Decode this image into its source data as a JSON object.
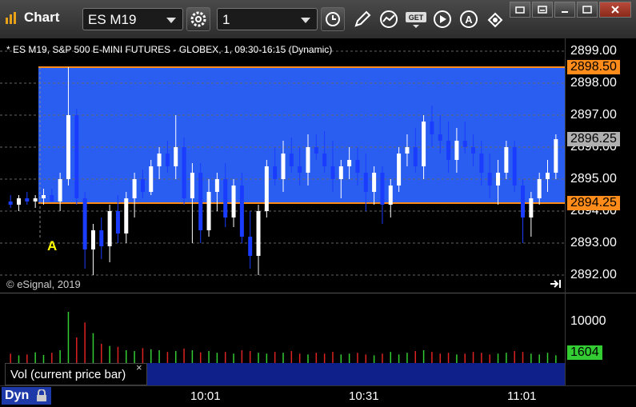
{
  "app": {
    "title": "Chart"
  },
  "toolbar": {
    "symbol": "ES M19",
    "interval": "1",
    "buttons": [
      "settings-icon",
      "clock-icon",
      "pencil-icon",
      "study-icon",
      "get-icon",
      "play-icon",
      "alert-icon",
      "link-icon"
    ]
  },
  "window": {
    "controls": [
      "restore",
      "minimize",
      "maximize",
      "close"
    ]
  },
  "chart": {
    "subtitle": "* ES M19, S&P 500 E-MINI FUTURES - GLOBEX, 1, 09:30-16:15 (Dynamic)",
    "copyright": "© eSignal, 2019",
    "marker": "A",
    "price_axis": [
      "2899.00",
      "2898.00",
      "2897.00",
      "2896.00",
      "2895.00",
      "2894.00",
      "2893.00",
      "2892.00"
    ],
    "price_tags": [
      {
        "label": "2898.50",
        "color": "#ff8c1a"
      },
      {
        "label": "2896.25",
        "color": "#b0b0b0"
      },
      {
        "label": "2894.25",
        "color": "#ff8c1a"
      }
    ],
    "range_box": {
      "high": 2898.5,
      "low": 2894.25,
      "color": "#2a5ef0"
    }
  },
  "volume": {
    "legend": "Vol (current price bar)",
    "close": "×",
    "axis_label": "10000",
    "current_tag": "1604",
    "current_color": "#33cc33"
  },
  "time_axis": [
    "10:01",
    "10:31",
    "11:01"
  ],
  "bottom": {
    "mode": "Dyn"
  },
  "chart_data": {
    "type": "candlestick",
    "title": "* ES M19, S&P 500 E-MINI FUTURES - GLOBEX, 1, 09:30-16:15 (Dynamic)",
    "ylim": [
      2891.5,
      2899.4
    ],
    "x_ticks": [
      "10:01",
      "10:31",
      "11:01"
    ],
    "candles": [
      [
        2894.3,
        2894.5,
        2894.1,
        2894.2
      ],
      [
        2894.2,
        2894.5,
        2894.0,
        2894.4
      ],
      [
        2894.4,
        2894.6,
        2894.2,
        2894.3
      ],
      [
        2894.3,
        2894.5,
        2894.1,
        2894.4
      ],
      [
        2894.4,
        2894.7,
        2894.2,
        2894.5
      ],
      [
        2894.5,
        2894.7,
        2894.3,
        2894.3
      ],
      [
        2894.3,
        2895.2,
        2894.0,
        2895.0
      ],
      [
        2895.0,
        2898.5,
        2894.8,
        2897.0
      ],
      [
        2897.0,
        2897.2,
        2894.2,
        2894.4
      ],
      [
        2894.4,
        2894.6,
        2892.2,
        2892.8
      ],
      [
        2892.8,
        2893.6,
        2892.0,
        2893.4
      ],
      [
        2893.4,
        2893.8,
        2892.5,
        2892.9
      ],
      [
        2892.9,
        2894.2,
        2892.4,
        2894.0
      ],
      [
        2894.0,
        2894.5,
        2893.0,
        2893.3
      ],
      [
        2893.3,
        2894.6,
        2893.0,
        2894.4
      ],
      [
        2894.4,
        2895.2,
        2893.8,
        2895.0
      ],
      [
        2895.0,
        2895.3,
        2894.4,
        2894.6
      ],
      [
        2894.6,
        2895.6,
        2894.5,
        2895.4
      ],
      [
        2895.4,
        2896.0,
        2895.0,
        2895.8
      ],
      [
        2895.8,
        2896.2,
        2895.2,
        2895.4
      ],
      [
        2895.4,
        2897.0,
        2895.0,
        2896.0
      ],
      [
        2896.0,
        2896.3,
        2894.2,
        2894.4
      ],
      [
        2894.4,
        2895.5,
        2893.0,
        2895.2
      ],
      [
        2895.2,
        2895.5,
        2893.0,
        2893.4
      ],
      [
        2893.4,
        2895.0,
        2893.2,
        2894.6
      ],
      [
        2894.6,
        2895.2,
        2894.0,
        2895.0
      ],
      [
        2895.0,
        2895.5,
        2893.5,
        2893.8
      ],
      [
        2893.8,
        2895.0,
        2893.5,
        2894.8
      ],
      [
        2894.8,
        2895.2,
        2893.0,
        2893.2
      ],
      [
        2893.2,
        2894.0,
        2892.2,
        2892.6
      ],
      [
        2892.6,
        2894.2,
        2892.0,
        2894.0
      ],
      [
        2894.0,
        2895.6,
        2893.8,
        2895.4
      ],
      [
        2895.4,
        2896.0,
        2894.8,
        2895.0
      ],
      [
        2895.0,
        2896.2,
        2894.6,
        2895.8
      ],
      [
        2895.8,
        2896.3,
        2895.2,
        2895.4
      ],
      [
        2895.4,
        2896.0,
        2894.8,
        2895.2
      ],
      [
        2895.2,
        2896.4,
        2894.8,
        2896.0
      ],
      [
        2896.0,
        2896.4,
        2895.6,
        2895.8
      ],
      [
        2895.8,
        2896.5,
        2895.2,
        2895.4
      ],
      [
        2895.4,
        2896.2,
        2894.6,
        2895.0
      ],
      [
        2895.0,
        2895.6,
        2894.4,
        2895.4
      ],
      [
        2895.4,
        2896.0,
        2895.0,
        2895.6
      ],
      [
        2895.6,
        2896.0,
        2894.8,
        2895.2
      ],
      [
        2895.2,
        2895.8,
        2894.0,
        2894.6
      ],
      [
        2894.6,
        2895.4,
        2894.2,
        2895.2
      ],
      [
        2895.2,
        2895.4,
        2893.6,
        2894.2
      ],
      [
        2894.2,
        2895.0,
        2893.8,
        2894.8
      ],
      [
        2894.8,
        2896.0,
        2894.6,
        2895.8
      ],
      [
        2895.8,
        2896.4,
        2895.4,
        2896.0
      ],
      [
        2896.0,
        2896.6,
        2895.2,
        2895.4
      ],
      [
        2895.4,
        2897.0,
        2895.0,
        2896.8
      ],
      [
        2896.8,
        2897.3,
        2896.0,
        2896.4
      ],
      [
        2896.4,
        2897.0,
        2895.8,
        2896.2
      ],
      [
        2896.2,
        2896.8,
        2895.2,
        2895.6
      ],
      [
        2895.6,
        2896.6,
        2895.2,
        2896.2
      ],
      [
        2896.2,
        2896.8,
        2895.8,
        2896.0
      ],
      [
        2896.0,
        2896.4,
        2895.4,
        2895.8
      ],
      [
        2895.8,
        2896.2,
        2894.8,
        2895.2
      ],
      [
        2895.2,
        2895.8,
        2894.4,
        2894.8
      ],
      [
        2894.8,
        2895.6,
        2894.2,
        2895.2
      ],
      [
        2895.2,
        2896.2,
        2895.0,
        2896.0
      ],
      [
        2896.0,
        2896.2,
        2894.6,
        2894.8
      ],
      [
        2894.8,
        2895.0,
        2893.0,
        2893.8
      ],
      [
        2893.8,
        2894.6,
        2893.2,
        2894.4
      ],
      [
        2894.4,
        2895.2,
        2894.2,
        2895.0
      ],
      [
        2895.0,
        2895.6,
        2894.6,
        2895.2
      ],
      [
        2895.2,
        2896.4,
        2895.0,
        2896.25
      ]
    ],
    "volume": [
      22,
      18,
      20,
      25,
      19,
      24,
      30,
      120,
      60,
      95,
      70,
      45,
      40,
      38,
      30,
      28,
      35,
      32,
      30,
      26,
      28,
      34,
      30,
      25,
      28,
      24,
      26,
      22,
      30,
      28,
      24,
      22,
      26,
      24,
      28,
      22,
      20,
      24,
      22,
      26,
      20,
      22,
      24,
      20,
      18,
      22,
      26,
      20,
      24,
      28,
      30,
      26,
      22,
      24,
      20,
      22,
      26,
      24,
      20,
      22,
      24,
      28,
      26,
      22,
      20,
      24,
      18
    ]
  }
}
